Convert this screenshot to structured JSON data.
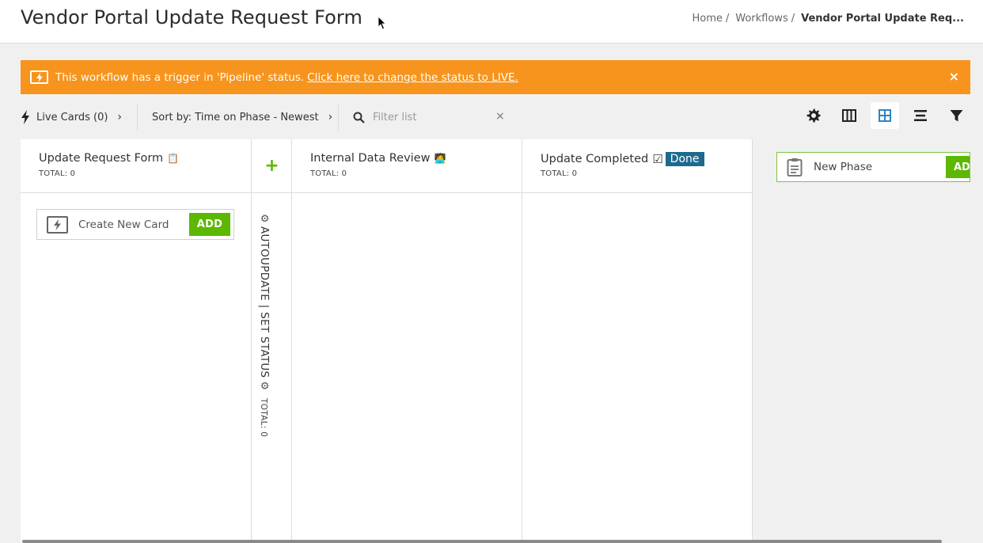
{
  "header": {
    "title": "Vendor Portal Update Request Form",
    "breadcrumb": {
      "home": "Home",
      "workflows": "Workflows",
      "current": "Vendor Portal Update Req...",
      "separator": "/"
    }
  },
  "banner": {
    "text": "This workflow has a trigger in 'Pipeline' status.",
    "link": "Click here to change the status to LIVE.",
    "close": "×",
    "color": "#f7941d"
  },
  "toolbar": {
    "live_cards": "Live Cards (0)",
    "sort_by": "Sort by: Time on Phase - Newest",
    "filter_placeholder": "Filter list",
    "clear": "×"
  },
  "columns": [
    {
      "title": "Update Request Form",
      "emoji": "📋",
      "total": "TOTAL: 0"
    },
    {
      "title": "Internal Data Review",
      "emoji": "🧑‍💻",
      "total": "TOTAL: 0"
    },
    {
      "title": "Update Completed",
      "emoji": "☑",
      "badge": "Done",
      "total": "TOTAL: 0"
    }
  ],
  "create_card": {
    "label": "Create New Card",
    "add": "ADD"
  },
  "automation_column": {
    "plus": "+",
    "label": "AUTOUPDATE | SET STATUS",
    "total": "TOTAL: 0"
  },
  "new_phase": {
    "placeholder": "New Phase",
    "add": "ADD"
  },
  "colors": {
    "accent_green": "#5cb800",
    "badge_blue": "#1d6a8e",
    "banner_orange": "#f7941d"
  }
}
